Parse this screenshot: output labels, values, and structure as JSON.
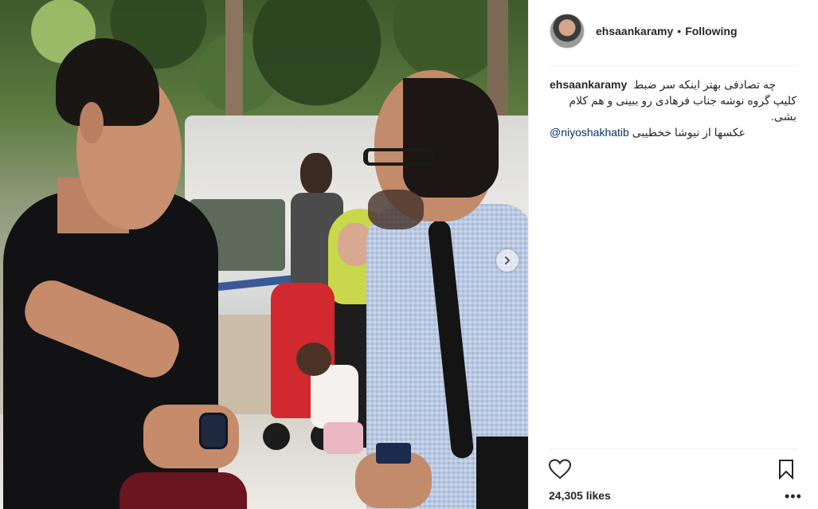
{
  "post": {
    "username": "ehsaankaramy",
    "separator": "•",
    "follow_status": "Following",
    "caption": {
      "username": "ehsaankaramy",
      "line1": "چه تصادفی بهتر اینکه سر ضبط",
      "line2": "کلیپ گروه نوشه جناب فرهادی رو ببینی و هم کلام",
      "line3": "بشی.",
      "mention": "@niyoshakhatib",
      "line4": "عکسها از نیوشا خخطیبی"
    },
    "likes": "24,305 likes",
    "more_label": "•••"
  },
  "icons": {
    "heart": "heart-icon",
    "bookmark": "bookmark-icon",
    "next": "chevron-right-icon"
  },
  "colors": {
    "text": "#262626",
    "mention": "#003569",
    "divider": "#efefef"
  }
}
